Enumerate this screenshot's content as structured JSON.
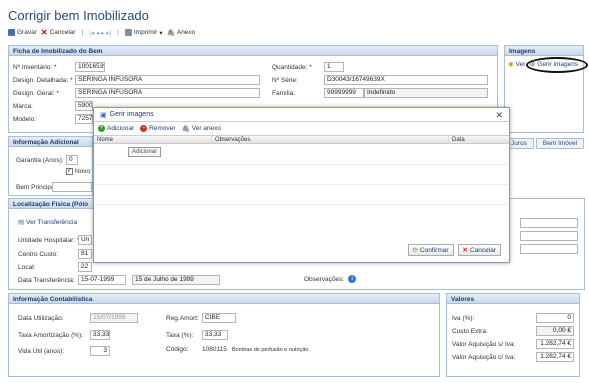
{
  "page": {
    "title": "Corrigir bem Imobilizado"
  },
  "toolbar": {
    "save": "Gravar",
    "cancel": "Cancelar",
    "nav": "|◂  ◂  ▸  ▸|",
    "print": "Imprimir",
    "attach": "Anexo"
  },
  "ficha": {
    "header": "Ficha de Imobilizado do Bem",
    "inventario_label": "Nº Inventário: *",
    "inventario_value": "10016539",
    "quantidade_label": "Quantidade: *",
    "quantidade_value": "1",
    "design_detalhada_label": "Design. Detalhada: *",
    "design_detalhada_value": "SERINGA INFUSORA",
    "serie_label": "Nº Série:",
    "serie_value": "D30043/16749639X",
    "design_geral_label": "Design. Geral: *",
    "design_geral_value": "SERINGA INFUSORA",
    "familia_label": "Família:",
    "familia_value": "99999999",
    "familia_desc": "Indefinido",
    "marca_label": "Marca:",
    "marca_value": "5900",
    "modelo_label": "Modelo:",
    "modelo_value": "7257"
  },
  "imagens": {
    "header": "Imagens",
    "ver": "Ver",
    "gerir": "Gerir imagens"
  },
  "tabs": [
    "Juros",
    "Bem Imóvel"
  ],
  "info_adicional": {
    "header": "Informação Adicional",
    "garantia_label": "Garantia (Anos):",
    "garantia_value": "0",
    "novo_label": "Novo",
    "bem_principal_label": "Bem Principal:"
  },
  "localizacao": {
    "header": "Localização Física (Pólo",
    "ver_transferencia": "Ver Transferência",
    "unidade_label": "Unidade Hospitalar: *",
    "unidade_value": "Un",
    "centro_label": "Centro Custo:",
    "centro_value": "81",
    "local_label": "Local:",
    "local_value": "22",
    "data_label": "Data Transferência:",
    "data_value": "15-07-1999",
    "data_extenso": "15 de Julho de 1999",
    "observacoes_label": "Observações:"
  },
  "contabilistica": {
    "header": "Informação Contabilística",
    "data_utilizacao_label": "Data Utilização:",
    "data_utilizacao_value": "15/07/1999",
    "reg_amort_label": "Reg.Amort:",
    "reg_amort_value": "CIBE",
    "taxa_amort_label": "Taxa Amortização (%):",
    "taxa_amort_value": "33,33",
    "taxa_label": "Taxa (%):",
    "taxa_value": "33,33",
    "vida_util_label": "Vida Útil (anos):",
    "vida_util_value": "3",
    "codigo_label": "Código:",
    "codigo_value": "1080115",
    "codigo_desc": "Bombas de perfusão e nutrição"
  },
  "valores": {
    "header": "Valores",
    "iva_label": "Iva (%):",
    "iva_value": "0",
    "custo_label": "Custo Extra:",
    "custo_value": "0,00 €",
    "valor_s_iva_label": "Valor Aquisição s/ Iva:",
    "valor_s_iva_value": "1.282,74 €",
    "valor_c_iva_label": "Valor Aquisição c/ Iva:",
    "valor_c_iva_value": "1.282,74 €"
  },
  "modal": {
    "title": "Gerir imagens",
    "add": "Adicionar",
    "remove": "Remover",
    "view": "Ver anexo",
    "col_nome": "Nome",
    "col_obs": "Observações",
    "col_data": "Data",
    "tooltip": "Adicionar",
    "confirm": "Confirmar",
    "cancel": "Cancelar"
  },
  "colors": {
    "accent": "#1e3d6b",
    "panel_border": "#a9bfd6",
    "add_green": "#3a9a2a",
    "remove_red": "#d03020"
  }
}
